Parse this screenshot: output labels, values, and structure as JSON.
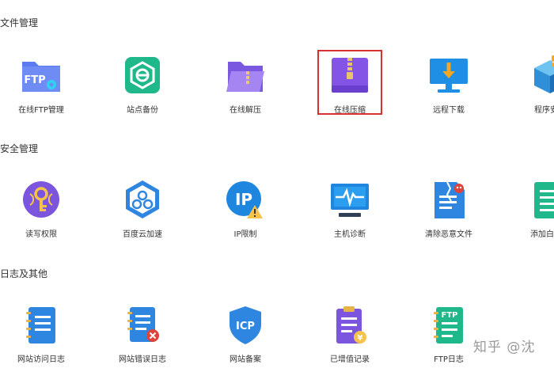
{
  "sections": {
    "file": "文件管理",
    "security": "安全管理",
    "logs": "日志及其他"
  },
  "file_tiles": [
    "在线FTP管理",
    "站点备份",
    "在线解压",
    "在线压缩",
    "远程下载",
    "程序安装"
  ],
  "security_tiles": [
    "读写权限",
    "百度云加速",
    "IP限制",
    "主机诊断",
    "清除恶意文件",
    "添加白名单"
  ],
  "log_tiles": [
    "网站访问日志",
    "网站错误日志",
    "网站备案",
    "已增值记录",
    "FTP日志"
  ],
  "icon_text": {
    "ftp": "FTP",
    "ip": "IP",
    "icp": "ICP",
    "ftp_log": "FTP"
  },
  "highlighted_tile": "在线压缩",
  "watermark": "知乎 @沈",
  "colors": {
    "ftp_folder": "#5b7cf0",
    "backup": "#1fb88a",
    "unzip": "#8a67e8",
    "zip": "#8454e6",
    "download": "#1f8fe6",
    "orange": "#f5a623",
    "red": "#e0433a",
    "highlight_border": "#d9302f"
  }
}
